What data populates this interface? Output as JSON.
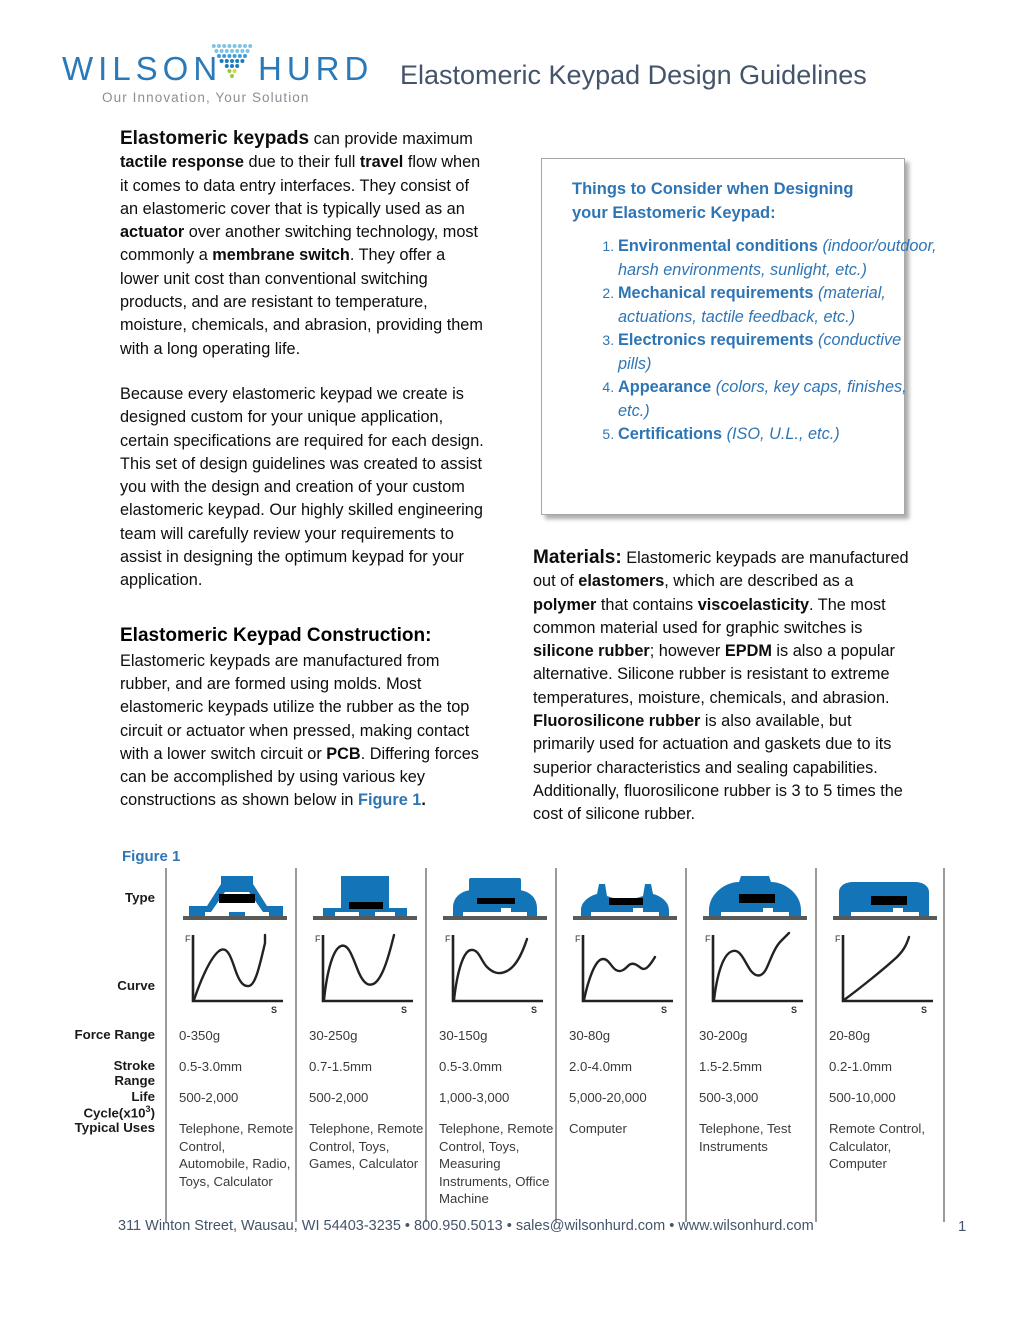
{
  "header": {
    "logo_left": "WILSON",
    "logo_right": "HURD",
    "tagline": "Our Innovation, Your Solution",
    "title": "Elastomeric Keypad Design Guidelines",
    "brand_blue": "#2a7ab9",
    "title_color": "#44546a"
  },
  "left_column": {
    "intro_lead": "Elastomeric keypads",
    "intro_rest": " can provide maximum ",
    "intro_b1": "tactile response",
    "intro_p1_c": " due to their full ",
    "intro_b2": "travel",
    "intro_p1_d": " flow when it comes to data entry interfaces. They consist of an elastomeric cover that is typically used as an ",
    "intro_b3": "actuator",
    "intro_p1_e": " over another switching technology, most commonly a ",
    "intro_b4": "membrane switch",
    "intro_p1_f": ". They offer a lower unit cost than conventional switching products, and are resistant to temperature, moisture, chemicals, and abrasion, providing them with a long operating life.",
    "paragraph2": "Because every elastomeric keypad we create is designed custom for your unique application, certain specifications are required for each design. This set of design guidelines was created to assist you with the design and creation of your custom elastomeric keypad. Our highly skilled engineering team will carefully review your requirements to assist in designing the optimum keypad for your application.",
    "construction_heading": "Elastomeric Keypad Construction:",
    "construction_a": "Elastomeric keypads are manufactured from rubber, and are formed using molds. Most elastomeric keypads utilize the rubber as the top circuit or actuator when pressed, making contact with a lower switch circuit or ",
    "construction_b1": "PCB",
    "construction_b": ". Differing forces can be accomplished by using various key constructions as shown below in ",
    "construction_figref": "Figure 1",
    "construction_c": "."
  },
  "consider_box": {
    "title": "Things to Consider when Designing your Elastomeric Keypad:",
    "items": [
      {
        "bold": "Environmental conditions",
        "italic": " (indoor/outdoor, harsh environments, sunlight, etc.)"
      },
      {
        "bold": "Mechanical requirements",
        "italic": " (material, actuations, tactile feedback, etc.)"
      },
      {
        "bold": "Electronics requirements",
        "italic": " (conductive pills)"
      },
      {
        "bold": "Appearance",
        "italic": " (colors, key caps, finishes, etc.)"
      },
      {
        "bold": "Certifications",
        "italic": " (ISO, U.L., etc.)"
      }
    ],
    "accent": "#2e75b6"
  },
  "materials": {
    "heading": "Materials:",
    "t1": " Elastomeric keypads are manufactured out of ",
    "b1": "elastomers",
    "t2": ", which are described as a ",
    "b2": "polymer",
    "t3": " that contains ",
    "b3": "viscoelasticity",
    "t4": ".  The most common material used for graphic switches is ",
    "b4": "silicone rubber",
    "t5": "; however ",
    "b5": "EPDM",
    "t6": " is also a popular alternative. Silicone rubber is resistant to extreme temperatures, moisture, chemicals, and abrasion. ",
    "b6": "Fluorosilicone rubber",
    "t7": " is also available, but primarily used for actuation and gaskets due to its superior characteristics and sealing capabilities. Additionally, fluorosilicone rubber is 3 to 5 times the cost of silicone rubber."
  },
  "figure": {
    "label": "Figure 1",
    "row_labels": {
      "type": "Type",
      "curve": "Curve",
      "force": "Force Range",
      "stroke": "Stroke Range",
      "life_a": "Life Cycle(x10",
      "life_sup": "3",
      "life_b": ")",
      "uses": "Typical Uses"
    },
    "axis_f": "F",
    "axis_s": "S",
    "columns": [
      {
        "type_shape": "trapezoid-web-keycap",
        "curve_shape": "snap-peak-deep-valley",
        "force": "0-350g",
        "stroke": "0.5-3.0mm",
        "life": "500-2,000",
        "uses": "Telephone, Remote Control, Automobile, Radio, Toys, Calculator"
      },
      {
        "type_shape": "tall-block-keycap",
        "curve_shape": "sharp-snap-narrow-valley",
        "force": "30-250g",
        "stroke": "0.7-1.5mm",
        "life": "500-2,000",
        "uses": "Telephone, Remote Control, Toys, Games, Calculator"
      },
      {
        "type_shape": "dome-top-keycap",
        "curve_shape": "soft-snap-shallow-valley",
        "force": "30-150g",
        "stroke": "0.5-3.0mm",
        "life": "1,000-3,000",
        "uses": "Telephone, Remote Control, Toys, Measuring Instruments, Office Machine"
      },
      {
        "type_shape": "double-dome-flat-keycap",
        "curve_shape": "low-ripple-flat",
        "force": "30-80g",
        "stroke": "2.0-4.0mm",
        "life": "5,000-20,000",
        "uses": "Computer"
      },
      {
        "type_shape": "arch-dome-keycap",
        "curve_shape": "snap-valley-rising-tail",
        "force": "30-200g",
        "stroke": "1.5-2.5mm",
        "life": "500-3,000",
        "uses": "Telephone, Test Instruments"
      },
      {
        "type_shape": "low-profile-slab-keycap",
        "curve_shape": "linear-rising",
        "force": "20-80g",
        "stroke": "0.2-1.0mm",
        "life": "500-10,000",
        "uses": "Remote Control, Calculator, Computer"
      }
    ]
  },
  "footer": {
    "text": "311 Winton Street, Wausau, WI 54403-3235 • 800.950.5013 • sales@wilsonhurd.com • www.wilsonhurd.com",
    "page": "1"
  }
}
